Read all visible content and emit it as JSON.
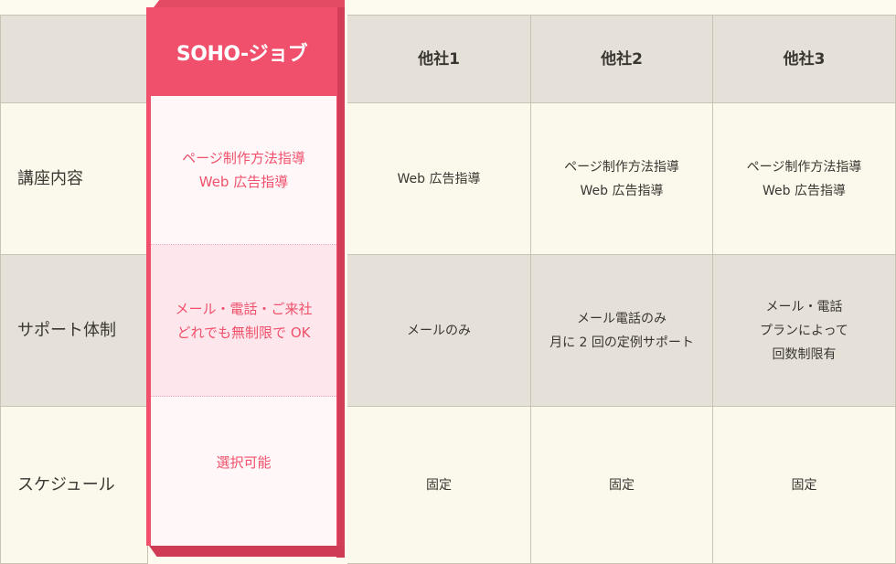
{
  "header": {
    "highlight": "SOHO-ジョブ",
    "col1": "他社1",
    "col2": "他社2",
    "col3": "他社3"
  },
  "rows": [
    {
      "label": "講座内容",
      "highlight": "ページ制作方法指導\nWeb 広告指導",
      "col1": "Web 広告指導",
      "col2": "ページ制作方法指導\nWeb 広告指導",
      "col3": "ページ制作方法指導\nWeb 広告指導"
    },
    {
      "label": "サポート体制",
      "highlight": "メール・電話・ご来社\nどれでも無制限で OK",
      "col1": "メールのみ",
      "col2": "メール電話のみ\n月に 2 回の定例サポート",
      "col3": "メール・電話\nプランによって\n回数制限有"
    },
    {
      "label": "スケジュール",
      "highlight": "選択可能",
      "col1": "固定",
      "col2": "固定",
      "col3": "固定"
    }
  ],
  "colors": {
    "highlight": "#f0506b",
    "header_bg": "#e6e1d8",
    "cell_bg": "#fbf8ec"
  }
}
